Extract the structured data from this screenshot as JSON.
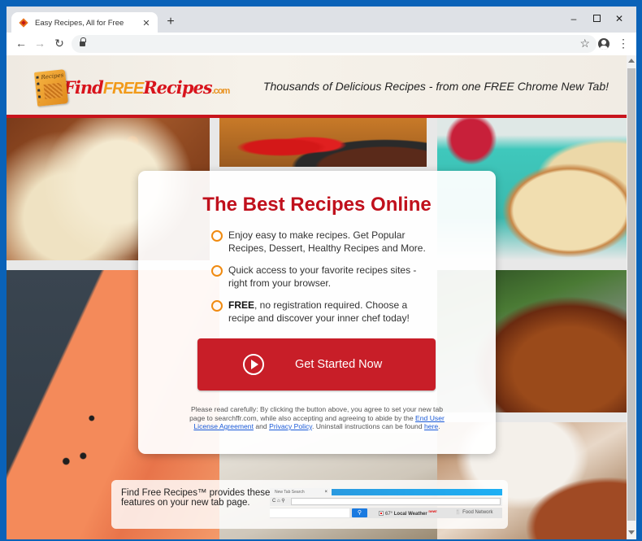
{
  "browser": {
    "tab_title": "Easy Recipes, All for Free",
    "tab_close": "✕",
    "new_tab": "+",
    "window_controls": {
      "minimize": "–",
      "close": "✕"
    },
    "nav": {
      "back": "←",
      "forward": "→",
      "reload": "↻"
    },
    "address_value": "",
    "bookmark_icon": "☆",
    "menu_icon": "⋮"
  },
  "header": {
    "logo": {
      "book_label": "Recipes",
      "find": "Find",
      "free": "FREE",
      "recipes": "Recipes",
      "com": ".com"
    },
    "tagline": "Thousands of Delicious Recipes - from one FREE Chrome New Tab!"
  },
  "modal": {
    "title": "The Best Recipes Online",
    "features": [
      {
        "bold": "",
        "text": "Enjoy easy to make recipes. Get Popular Recipes, Dessert, Healthy Recipes and More."
      },
      {
        "bold": "",
        "text": "Quick access to your favorite recipes sites - right from your browser."
      },
      {
        "bold": "FREE",
        "text": ", no registration required. Choose a recipe and discover your inner chef today!"
      }
    ],
    "cta_label": "Get Started Now",
    "disclaimer": {
      "part1": "Please read carefully: By clicking the button above, you agree to set your new tab page to searchffr.com, while also accepting and agreeing to abide by the ",
      "eula_link": "End User License Agreement",
      "part2": " and ",
      "privacy_link": "Privacy Policy",
      "part3": ". Uninstall instructions can be found ",
      "here_link": "here",
      "part4": "."
    }
  },
  "banner": {
    "text": "Find Free Recipes™ provides these features on your new tab page.",
    "preview": {
      "tab_title": "New Tab Search",
      "tab_close": "×",
      "url_icons": "C ⌂ ⚲",
      "search_button": "⚲",
      "weather_temp": "67°",
      "weather_label": "Local Weather",
      "weather_badge": "new!",
      "food_network": "Food Network"
    }
  },
  "colors": {
    "brand_red": "#c81e28",
    "bullet_orange": "#f08a10",
    "link_blue": "#1a5ad8",
    "window_frame": "#0a62b8"
  }
}
